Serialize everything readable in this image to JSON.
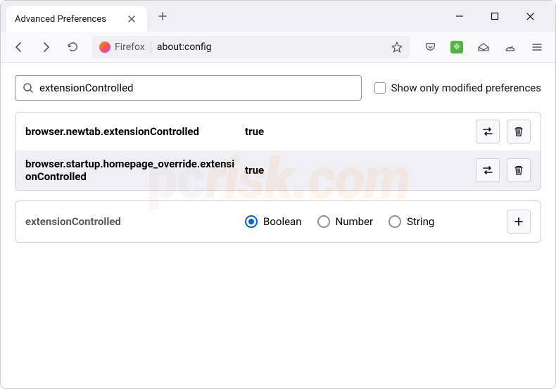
{
  "window": {
    "tab_title": "Advanced Preferences"
  },
  "urlbar": {
    "brand": "Firefox",
    "url": "about:config"
  },
  "search": {
    "value": "extensionControlled",
    "modified_only_label": "Show only modified preferences"
  },
  "prefs": [
    {
      "name": "browser.newtab.extensionControlled",
      "value": "true"
    },
    {
      "name": "browser.startup.homepage_override.extensionControlled",
      "value": "true"
    }
  ],
  "new_pref": {
    "name": "extensionControlled",
    "types": {
      "boolean": "Boolean",
      "number": "Number",
      "string": "String"
    }
  },
  "watermark": "risk.com"
}
